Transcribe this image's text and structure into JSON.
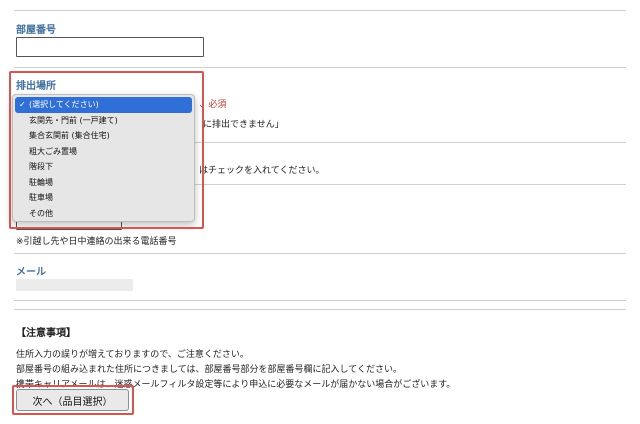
{
  "room": {
    "label": "部屋番号",
    "value": ""
  },
  "disposal": {
    "label": "排出場所",
    "required": "必須",
    "options": [
      "(選択してください)",
      "玄関先・門前 (一戸建て)",
      "集合玄関前 (集合住宅)",
      "粗大ごみ置場",
      "階段下",
      "駐輪場",
      "駐車場",
      "その他"
    ],
    "selected_index": 0,
    "note_partial": "に排出できません」"
  },
  "checkbox_note_partial": "はチェックを入れてください。",
  "phone": {
    "note": "※引越し先や日中連絡の出来る電話番号"
  },
  "mail": {
    "label": "メール"
  },
  "notes": {
    "title": "【注意事項】",
    "lines": [
      "住所入力の誤りが増えておりますので、ご注意ください。",
      "部屋番号の組み込まれた住所につきましては、部屋番号部分を部屋番号欄に記入してください。",
      "携帯キャリアメールは、迷惑メールフィルタ設定等により申込に必要なメールが届かない場合がございます。"
    ]
  },
  "next_button": {
    "label": "次へ（品目選択）"
  },
  "colors": {
    "label_blue": "#3f6f9f",
    "highlight_red": "#d9534f",
    "select_blue": "#2f6fd6"
  }
}
